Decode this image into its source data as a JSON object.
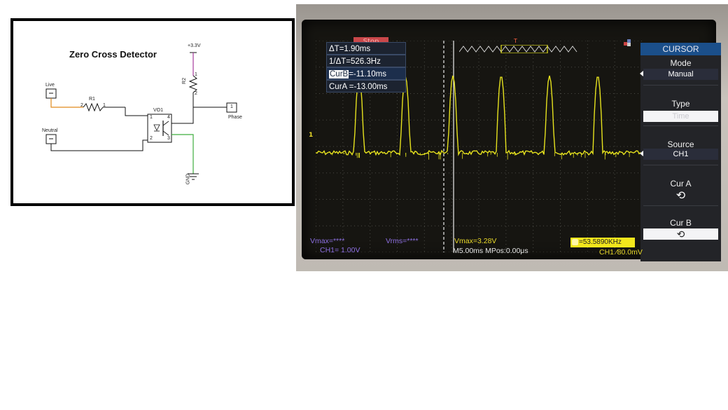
{
  "schematic": {
    "title": "Zero Cross Detector",
    "labels": {
      "supply": "+3.3V",
      "r1": "R1",
      "r2": "R2",
      "opto": "VO1",
      "live": "Live",
      "neutral": "Neutral",
      "phase": "Phase",
      "gnd": "GND",
      "pin_r1_left": "2",
      "pin_r1_right": "1",
      "pin_r2_top": "1",
      "pin_r2_bottom": "2",
      "pin_phase": "1",
      "pin_opto_1": "1",
      "pin_opto_2": "2",
      "pin_opto_3": "3",
      "pin_opto_4": "4"
    },
    "colors": {
      "live_wire": "#e08a1c",
      "supply_wire": "#a63b9c",
      "gnd_wire": "#3fae3f",
      "wire": "#1a1a1a"
    }
  },
  "scope": {
    "status": "Stop",
    "trigger_marker": "T",
    "readouts": {
      "delta_t": "ΔT=1.90ms",
      "inv_delta_t": "1/ΔT=526.3Hz",
      "curb_tag": "CurB",
      "curb_value": "=-11.10ms",
      "cura": "CurA =-13.00ms"
    },
    "menu": {
      "title": "CURSOR",
      "mode_label": "Mode",
      "mode_value": "Manual",
      "type_label": "Type",
      "type_value": "Time",
      "source_label": "Source",
      "source_value": "CH1",
      "cura_label": "Cur A",
      "curb_label": "Cur B",
      "knob_glyph": "⟲"
    },
    "frequency": "=53.5890KHz",
    "status_bar": {
      "vmax_ch": "Vmax=****",
      "vrms": "Vrms=****",
      "vmax": "Vmax=3.28V",
      "ch1_scale": "CH1= 1.00V",
      "timebase": "M5.00ms  MPos:0.00μs",
      "trigger": "CH1 ⁄80.0mV"
    },
    "channel_marker": "1",
    "waveform": {
      "pulse_count": 6,
      "baseline_level": 0.0,
      "pulse_peak": 3.28
    },
    "colors": {
      "trace": "#e6e21e",
      "screen": "#161511",
      "menu_title": "#1b4f8a",
      "stop": "#c9474a"
    }
  }
}
